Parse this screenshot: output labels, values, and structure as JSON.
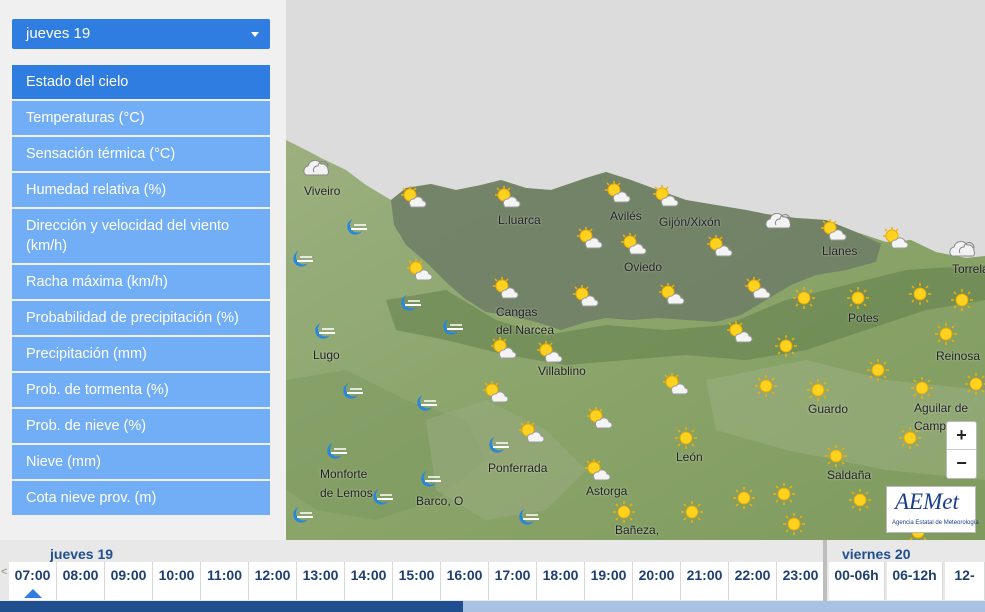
{
  "day_selector": {
    "value": "jueves 19"
  },
  "menu": {
    "items": [
      {
        "label": "Estado del cielo",
        "active": true
      },
      {
        "label": "Temperaturas (°C)"
      },
      {
        "label": "Sensación térmica (°C)"
      },
      {
        "label": "Humedad relativa (%)"
      },
      {
        "label": "Dirección y velocidad del viento (km/h)"
      },
      {
        "label": "Racha máxima (km/h)"
      },
      {
        "label": "Probabilidad de precipitación (%)"
      },
      {
        "label": "Precipitación (mm)"
      },
      {
        "label": "Prob. de tormenta (%)"
      },
      {
        "label": "Prob. de nieve (%)"
      },
      {
        "label": "Nieve (mm)"
      },
      {
        "label": "Cota nieve prov. (m)"
      }
    ]
  },
  "map": {
    "places": [
      "Viveiro",
      "Luarca",
      "Avilés",
      "Gijón/Xixón",
      "Llanes",
      "Torrela",
      "Oviedo",
      "Cangas del Narcea",
      "Potes",
      "Reinosa",
      "Lugo",
      "Villablino",
      "Guardo",
      "Aguilar de Campoo",
      "Ponferrada",
      "León",
      "Monforte de Lemos",
      "Astorga",
      "Saldaña",
      "Barco, O",
      "Bañeza,"
    ],
    "labels": {
      "viveiro": "Viveiro",
      "luarca": "L.luarca",
      "aviles": "Avilés",
      "gijon": "Gijón/Xixón",
      "llanes": "Llanes",
      "torrela": "Torrela",
      "oviedo": "Oviedo",
      "cangas1": "Cangas",
      "cangas2": "del Narcea",
      "potes": "Potes",
      "reinosa": "Reinosa",
      "lugo": "Lugo",
      "villablino": "Villablino",
      "guardo": "Guardo",
      "aguilar1": "Aguilar de",
      "aguilar2": "Campoo",
      "ponferrada": "Ponferrada",
      "leon": "León",
      "monforte1": "Monforte",
      "monforte2": "de Lemos",
      "astorga": "Astorga",
      "saldana": "Saldaña",
      "barco": "Barco, O",
      "baneza": "Bañeza,"
    },
    "icons": [
      "cloudy-icon",
      "sun-cloud-icon",
      "sun-icon",
      "moon-cloud-icon"
    ],
    "zoom_in": "+",
    "zoom_out": "−",
    "logo": {
      "main": "AEMet",
      "sub": "Agencia Estatal de Meteorología"
    },
    "colors": {
      "land": "#8aa46a",
      "mountain": "#4e6a3e",
      "sea": "#dcdcdc",
      "highlight": "#6b7a6b"
    }
  },
  "timebar": {
    "day1": "jueves 19",
    "day2": "viernes 20",
    "prev": "<",
    "next": ">",
    "slots_day1": [
      "07:00",
      "08:00",
      "09:00",
      "10:00",
      "11:00",
      "12:00",
      "13:00",
      "14:00",
      "15:00",
      "16:00",
      "17:00",
      "18:00",
      "19:00",
      "20:00",
      "21:00",
      "22:00",
      "23:00"
    ],
    "slots_day2": [
      "00-06h",
      "06-12h",
      "12-"
    ],
    "active_slot": "07:00",
    "progress": 0.47
  }
}
